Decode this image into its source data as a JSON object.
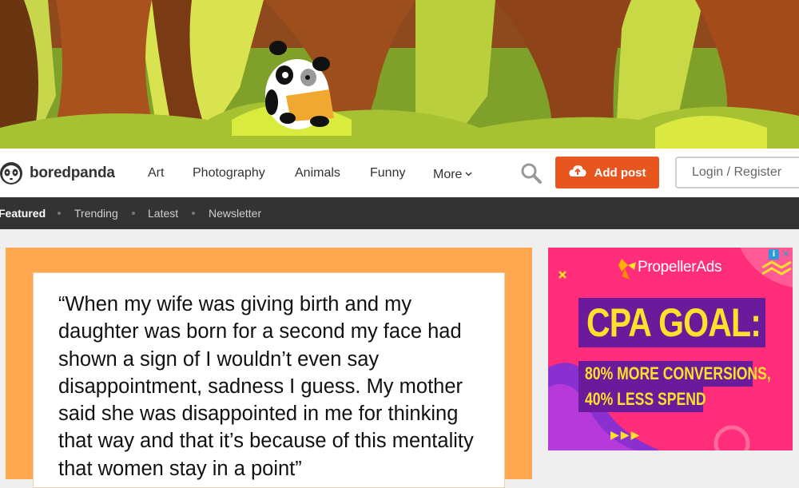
{
  "brand": {
    "name": "boredpanda"
  },
  "nav": {
    "items": [
      "Art",
      "Photography",
      "Animals",
      "Funny",
      "More"
    ],
    "search_icon": "search-icon",
    "add_post_label": "Add post",
    "login_label": "Login / Register"
  },
  "subnav": {
    "items": [
      "Featured",
      "Trending",
      "Latest",
      "Newsletter"
    ],
    "active": "Featured"
  },
  "post": {
    "quote": "“When my wife was giving birth and my daughter was born for a second my face had shown a sign of I wouldn’t even say disappointment, sadness I guess. My mother said she was disappointed in me for thinking that way and that it’s because of this mentality that women stay in a point”"
  },
  "ad": {
    "brand": "PropellerAds",
    "headline": "CPA GOAL:",
    "line1": "80% MORE CONVERSIONS,",
    "line2": "40% LESS SPEND",
    "arrows": "▶▶▶",
    "info_icon": "i",
    "close_icon": "✕"
  },
  "colors": {
    "accent": "#e8561f",
    "subnav_bg": "#333333",
    "card_bg": "#ffa850",
    "ad_bg": "#ff2d7a",
    "ad_text": "#ffe02a"
  }
}
